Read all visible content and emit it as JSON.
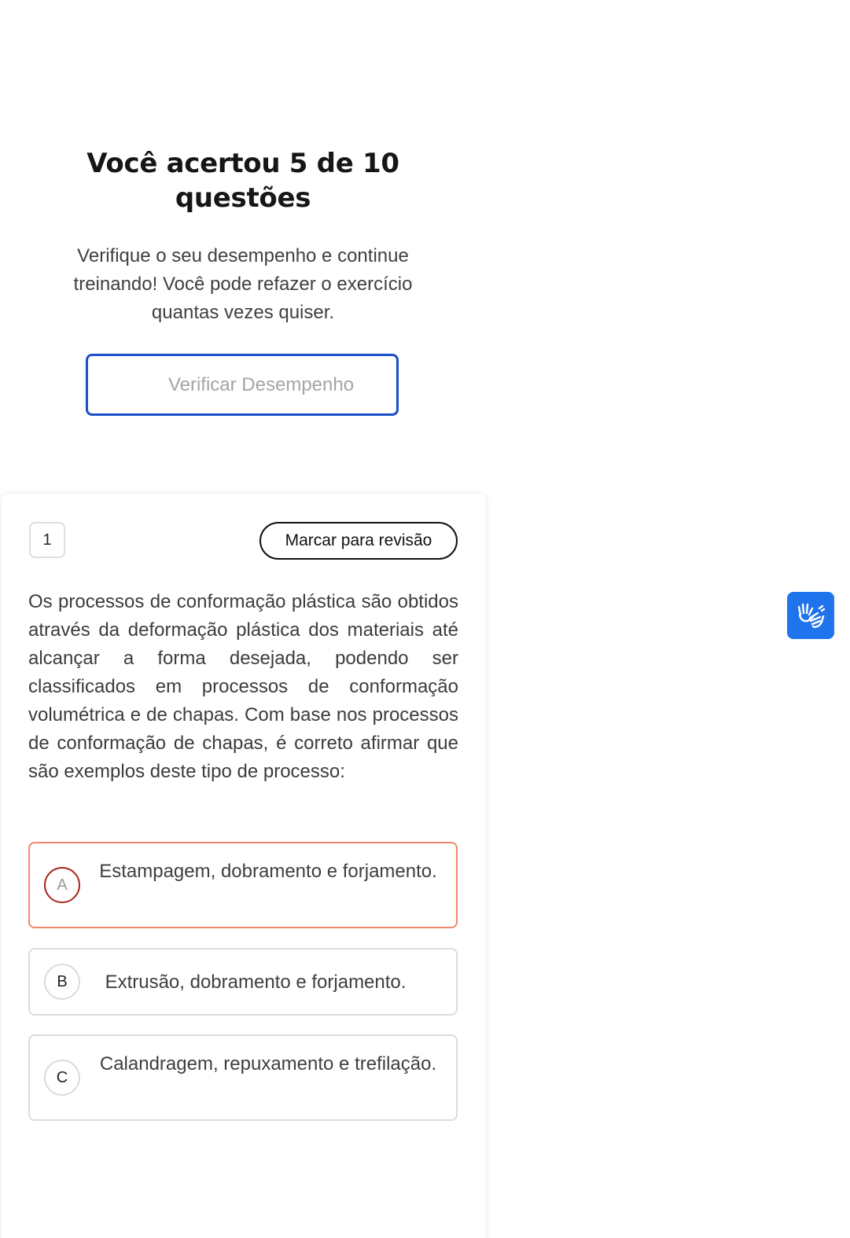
{
  "result": {
    "title": "Você acertou 5 de 10 questões",
    "subtitle": "Verifique o seu desempenho e continue treinando! Você pode refazer o exercício quantas vezes quiser.",
    "verify_button": "Verificar Desempenho"
  },
  "question": {
    "number": "1",
    "mark_review_label": "Marcar para revisão",
    "text": "Os processos de conformação plástica são obtidos através da deformação plástica dos materiais até alcançar a forma desejada, podendo ser classificados em processos de conformação volumétrica e de chapas. Com base nos processos de conformação de chapas, é correto afirmar que são exemplos deste tipo de processo:",
    "options": [
      {
        "letter": "A",
        "text": "Estampagem, dobramento e forjamento.",
        "selected": true
      },
      {
        "letter": "B",
        "text": "Extrusão, dobramento e forjamento.",
        "selected": false
      },
      {
        "letter": "C",
        "text": "Calandragem, repuxamento e trefilação.",
        "selected": false
      }
    ]
  },
  "accessibility": {
    "icon": "sign-language-hands-icon",
    "color": "#1f73ec"
  },
  "colors": {
    "primary_border": "#1b4fc9",
    "selected_border": "#f0876a",
    "selected_letter_border": "#a8281c"
  }
}
